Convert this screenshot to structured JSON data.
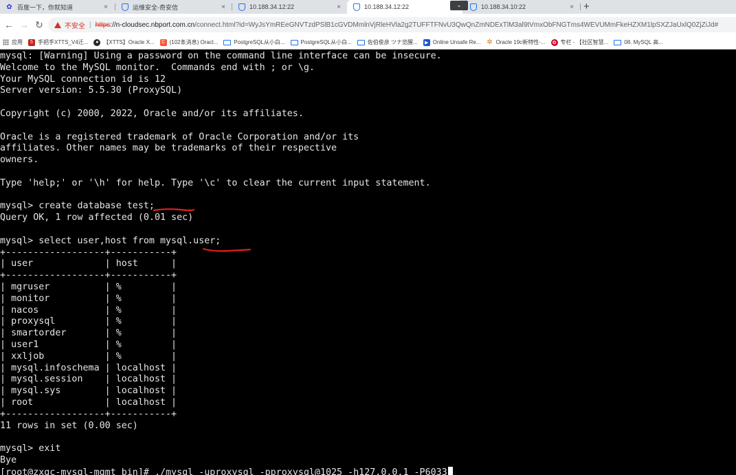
{
  "browser": {
    "tabs": [
      {
        "label": "百度一下，你就知道",
        "icon": "baidu-paw-icon",
        "active": false
      },
      {
        "label": "运维安全-奇安信",
        "icon": "shield-icon",
        "active": false
      },
      {
        "label": "10.188.34.12:22",
        "icon": "shield-icon",
        "active": false
      },
      {
        "label": "10.188.34.12:22",
        "icon": "shield-icon",
        "active": true
      },
      {
        "label": "10.188.34.10:22",
        "icon": "shield-icon",
        "active": false
      }
    ],
    "new_tab_label": "+",
    "close_glyph": "×",
    "address": {
      "security_label": "不安全",
      "scheme": "https",
      "host": "://n-cloudsec.nbport.com.cn",
      "path": "/connect.html?id=WyJsYmREeGNVTzdPSlB1cGVDMmlnVjRleHVla2g2TUFFTFNvU3QwQnZmNDExTlM3al9tVmxObFNGTms4WEVUMmFkeHZXM1lpSXZJaUxlQ0ZjZiJd#"
    },
    "bookmarks": [
      {
        "label": "应用",
        "icon": "apps-icon"
      },
      {
        "label": "手把手XTTS_V4迁...",
        "icon": "bookmark-red-icon"
      },
      {
        "label": "【XTTS】Oracle X...",
        "icon": "github-icon"
      },
      {
        "label": "(102条消息) Oracl...",
        "icon": "csdn-icon"
      },
      {
        "label": "PostgreSQL从小白...",
        "icon": "folder-icon"
      },
      {
        "label": "PostgreSQL从小白...",
        "icon": "folder-icon"
      },
      {
        "label": "佐伯俊彦 ツナ览醒...",
        "icon": "folder-icon"
      },
      {
        "label": "Online Unsafe Re...",
        "icon": "pin-icon"
      },
      {
        "label": "Oracle 19c新特性-...",
        "icon": "gear-icon"
      },
      {
        "label": "专栏 - 【社区智慧...",
        "icon": "huawei-icon"
      },
      {
        "label": "08. MySQL 高...",
        "icon": "folder-icon"
      }
    ],
    "colors": {
      "tabstrip": "#dee1e6",
      "insecure": "#d93025",
      "link": "#1a73e8"
    }
  },
  "terminal": {
    "lines": [
      "mysql: [Warning] Using a password on the command line interface can be insecure.",
      "Welcome to the MySQL monitor.  Commands end with ; or \\g.",
      "Your MySQL connection id is 12",
      "Server version: 5.5.30 (ProxySQL)",
      "",
      "Copyright (c) 2000, 2022, Oracle and/or its affiliates.",
      "",
      "Oracle is a registered trademark of Oracle Corporation and/or its",
      "affiliates. Other names may be trademarks of their respective",
      "owners.",
      "",
      "Type 'help;' or '\\h' for help. Type '\\c' to clear the current input statement.",
      "",
      "mysql> create database test;",
      "Query OK, 1 row affected (0.01 sec)",
      "",
      "mysql> select user,host from mysql.user;",
      "+------------------+-----------+",
      "| user             | host      |",
      "+------------------+-----------+",
      "| mgruser          | %         |",
      "| monitor          | %         |",
      "| nacos            | %         |",
      "| proxysql         | %         |",
      "| smartorder       | %         |",
      "| user1            | %         |",
      "| xxljob           | %         |",
      "| mysql.infoschema | localhost |",
      "| mysql.session    | localhost |",
      "| mysql.sys        | localhost |",
      "| root             | localhost |",
      "+------------------+-----------+",
      "11 rows in set (0.00 sec)",
      "",
      "mysql> exit",
      "Bye",
      "[root@zxgc-mysql-mgmt bin]# ./mysql -uproxysql -pproxysql@1025 -h127.0.0.1 -P6033"
    ],
    "colors": {
      "background": "#000000",
      "foreground": "#e6e6e6",
      "annotation": "#e02020"
    }
  }
}
